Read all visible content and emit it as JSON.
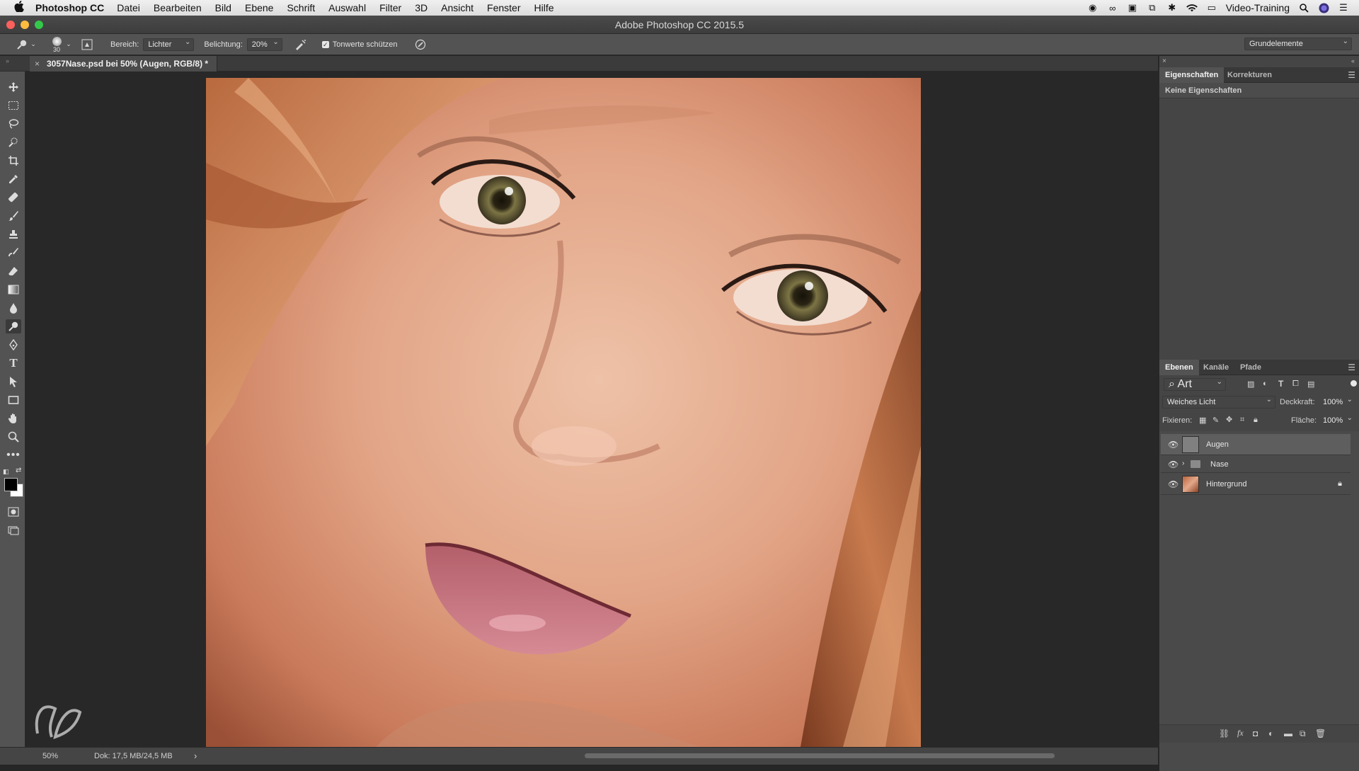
{
  "menubar": {
    "app_name": "Photoshop CC",
    "items": [
      "Datei",
      "Bearbeiten",
      "Bild",
      "Ebene",
      "Schrift",
      "Auswahl",
      "Filter",
      "3D",
      "Ansicht",
      "Fenster",
      "Hilfe"
    ],
    "user": "Video-Training"
  },
  "window": {
    "title": "Adobe Photoshop CC 2015.5"
  },
  "options": {
    "brush_size": "30",
    "range_label": "Bereich:",
    "range_value": "Lichter",
    "exposure_label": "Belichtung:",
    "exposure_value": "20%",
    "protect_tones_label": "Tonwerte schützen",
    "workspace": "Grundelemente"
  },
  "document": {
    "tab_title": "3057Nase.psd bei 50% (Augen, RGB/8) *",
    "close_glyph": "×"
  },
  "status": {
    "zoom": "50%",
    "doc_info": "Dok: 17,5 MB/24,5 MB",
    "arrow": "›"
  },
  "properties_panel": {
    "tabs": [
      "Eigenschaften",
      "Korrekturen"
    ],
    "message": "Keine Eigenschaften"
  },
  "layers_panel": {
    "tabs": [
      "Ebenen",
      "Kanäle",
      "Pfade"
    ],
    "filter_kind": "Art",
    "blend_mode": "Weiches Licht",
    "opacity_label": "Deckkraft:",
    "opacity_value": "100%",
    "lock_label": "Fixieren:",
    "fill_label": "Fläche:",
    "fill_value": "100%",
    "layers": [
      {
        "name": "Augen",
        "type": "layer"
      },
      {
        "name": "Nase",
        "type": "group"
      },
      {
        "name": "Hintergrund",
        "type": "background"
      }
    ]
  },
  "colors": {
    "accent_close": "#fc605c",
    "accent_min": "#fdbc40",
    "accent_max": "#34c84a"
  }
}
